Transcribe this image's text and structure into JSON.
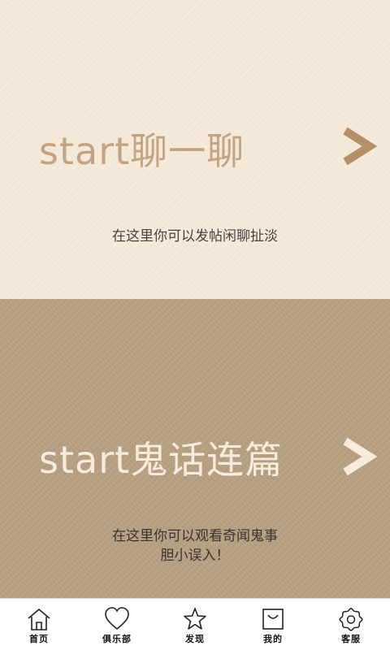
{
  "sections": [
    {
      "title": "start聊一聊",
      "description_lines": [
        "在这里你可以发帖闲聊扯淡"
      ]
    },
    {
      "title": "start鬼话连篇",
      "description_lines": [
        "在这里你可以观看奇闻鬼事",
        "胆小误入！"
      ]
    }
  ],
  "nav": {
    "items": [
      {
        "label": "首页",
        "icon": "home-icon"
      },
      {
        "label": "俱乐部",
        "icon": "heart-icon"
      },
      {
        "label": "发现",
        "icon": "star-icon"
      },
      {
        "label": "我的",
        "icon": "bag-icon"
      },
      {
        "label": "客服",
        "icon": "gear-icon"
      }
    ]
  },
  "colors": {
    "top_panel_bg": "#f7ecdb",
    "bottom_panel_bg": "#b9a284",
    "top_title_color": "#c2a484",
    "bottom_title_color": "#f7ecdb"
  }
}
